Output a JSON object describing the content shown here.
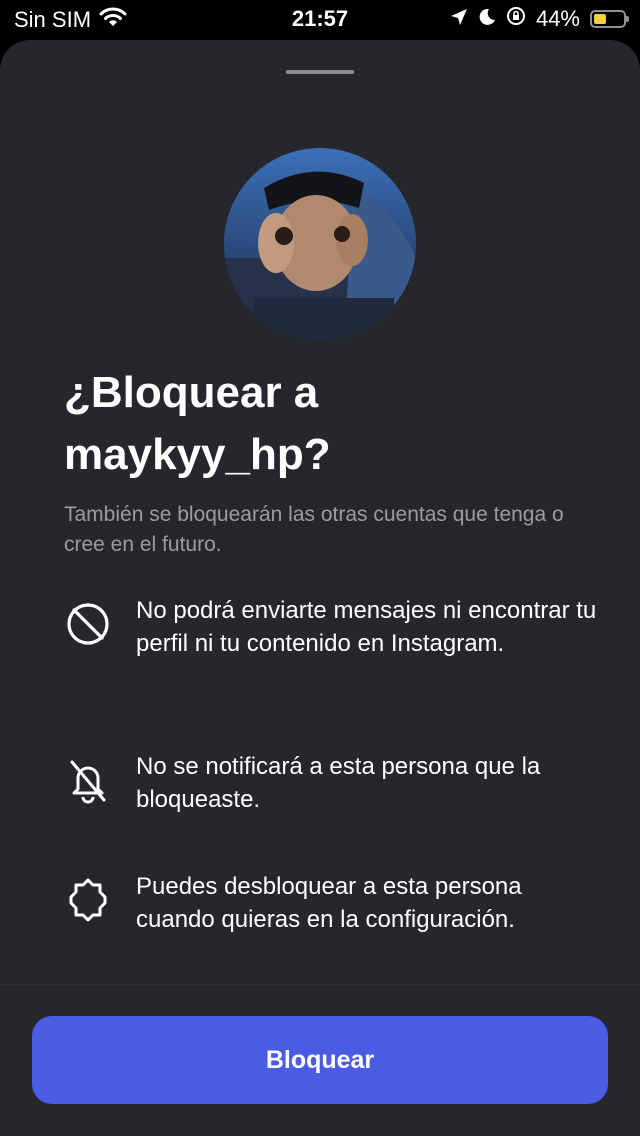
{
  "status_bar": {
    "carrier": "Sin SIM",
    "time": "21:57",
    "battery_percent": "44%",
    "battery_level": 0.44,
    "icons": [
      "wifi-icon",
      "location-icon",
      "moon-icon",
      "orientation-lock-icon",
      "battery-icon"
    ]
  },
  "dialog": {
    "avatar": "profile-avatar",
    "title_line1": "¿Bloquear a",
    "title_line2": "maykyy_hp?",
    "subtitle": "También se bloquearán las otras cuentas que tenga o cree en el futuro.",
    "items": [
      {
        "icon": "blocked-circle-icon",
        "text": "No podrá enviarte mensajes ni encontrar tu perfil ni tu contenido en Instagram."
      },
      {
        "icon": "notifications-off-icon",
        "text": "No se notificará a esta persona que la bloqueaste."
      },
      {
        "icon": "settings-gear-icon",
        "text": "Puedes desbloquear a esta persona cuando quieras en la configuración."
      }
    ],
    "button_label": "Bloquear"
  },
  "colors": {
    "sheet_background": "#25272c",
    "button": "#4a5ce4",
    "subtitle": "#9a9ca3",
    "battery": "#f5d13a"
  }
}
